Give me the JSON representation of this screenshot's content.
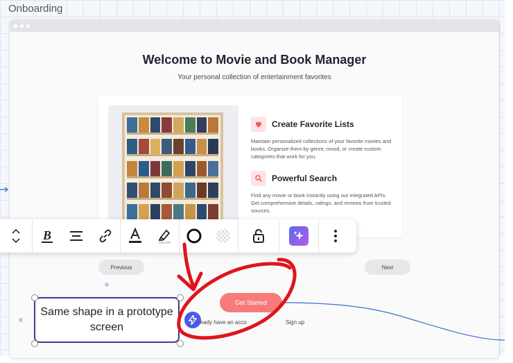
{
  "board": {
    "title": "Onboarding"
  },
  "screen": {
    "title": "Welcome to Movie and Book Manager",
    "subtitle": "Your personal collection of entertainment favorites",
    "features": [
      {
        "icon": "heart-icon",
        "title": "Create Favorite Lists",
        "description": "Maintain personalized collections of your favorite movies and books. Organize them by genre, mood, or create custom categories that work for you."
      },
      {
        "icon": "search-icon",
        "title": "Powerful Search",
        "description": "Find any movie or book instantly using our integrated APIs. Get comprehensive details, ratings, and reviews from trusted sources."
      }
    ],
    "prev_label": "Previous",
    "next_label": "Next",
    "cta_label": "Get Started",
    "signin_prefix": "ready have an acco",
    "signup_label": "Sign up"
  },
  "sticky_note": {
    "text": "Same shape in a prototype screen"
  },
  "toolbar": {
    "items": [
      "stepper-arrows",
      "bold-icon",
      "align-center-icon",
      "link-icon",
      "text-color-icon",
      "highlight-icon",
      "border-circle-icon",
      "transparent-fill-icon",
      "unlock-icon",
      "ai-sparkle-icon",
      "more-icon"
    ]
  },
  "colors": {
    "accent": "#f77b7b",
    "annotation": "#e0141e",
    "selection": "#3a3f8f",
    "ai": "#7c5cf0"
  }
}
